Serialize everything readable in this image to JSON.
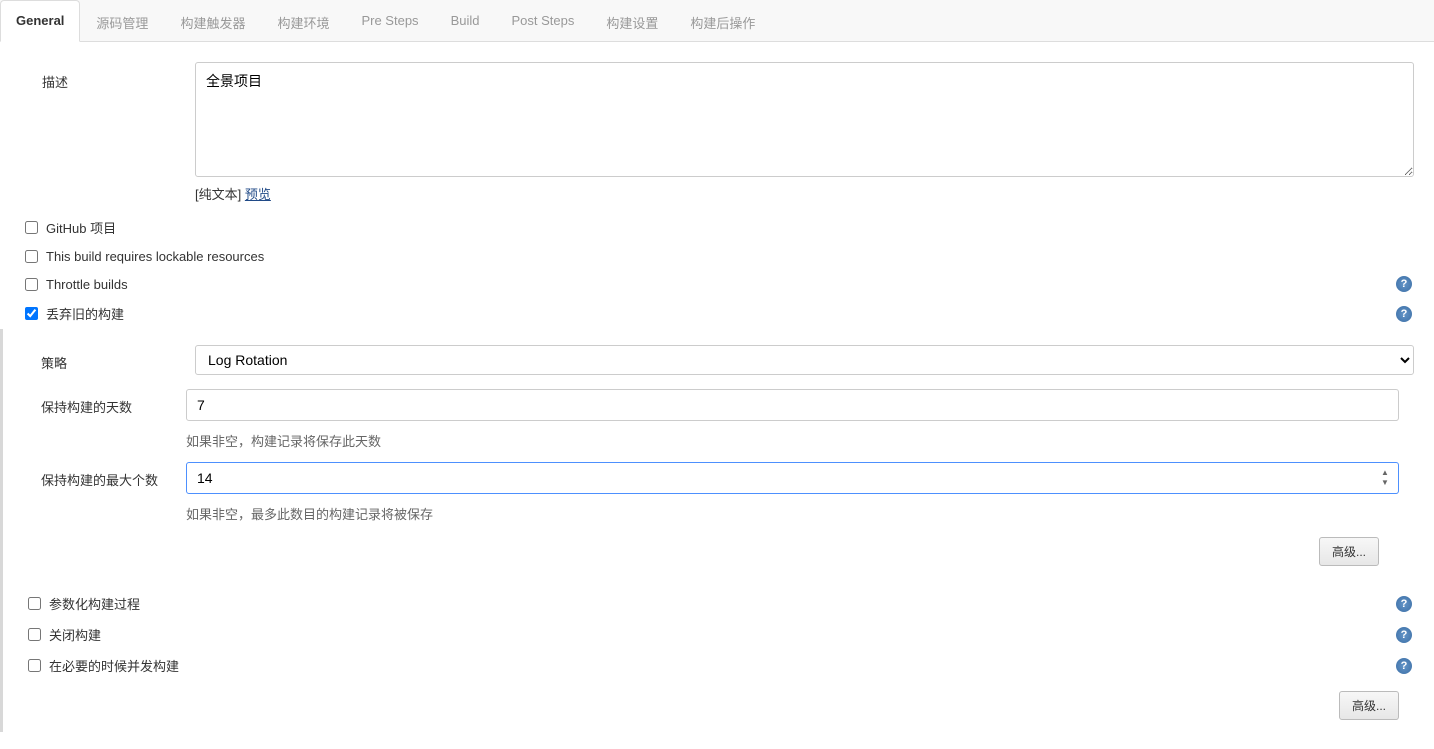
{
  "tabs": [
    {
      "label": "General",
      "active": true
    },
    {
      "label": "源码管理",
      "active": false
    },
    {
      "label": "构建触发器",
      "active": false
    },
    {
      "label": "构建环境",
      "active": false
    },
    {
      "label": "Pre Steps",
      "active": false
    },
    {
      "label": "Build",
      "active": false
    },
    {
      "label": "Post Steps",
      "active": false
    },
    {
      "label": "构建设置",
      "active": false
    },
    {
      "label": "构建后操作",
      "active": false
    }
  ],
  "description": {
    "label": "描述",
    "value": "全景项目",
    "plaintext": "[纯文本]",
    "preview": "预览"
  },
  "checkboxes": {
    "github_project": {
      "label": "GitHub 项目",
      "checked": false
    },
    "lockable": {
      "label": "This build requires lockable resources",
      "checked": false
    },
    "throttle": {
      "label": "Throttle builds",
      "checked": false,
      "help": true
    },
    "discard": {
      "label": "丢弃旧的构建",
      "checked": true,
      "help": true
    },
    "parameterized": {
      "label": "参数化构建过程",
      "checked": false,
      "help": true
    },
    "disable": {
      "label": "关闭构建",
      "checked": false,
      "help": true
    },
    "concurrent": {
      "label": "在必要的时候并发构建",
      "checked": false,
      "help": true
    }
  },
  "strategy": {
    "label": "策略",
    "value": "Log Rotation"
  },
  "days": {
    "label": "保持构建的天数",
    "value": "7",
    "hint": "如果非空，构建记录将保存此天数"
  },
  "maxnum": {
    "label": "保持构建的最大个数",
    "value": "14",
    "hint": "如果非空，最多此数目的构建记录将被保存"
  },
  "advanced": "高级...",
  "help_glyph": "?"
}
